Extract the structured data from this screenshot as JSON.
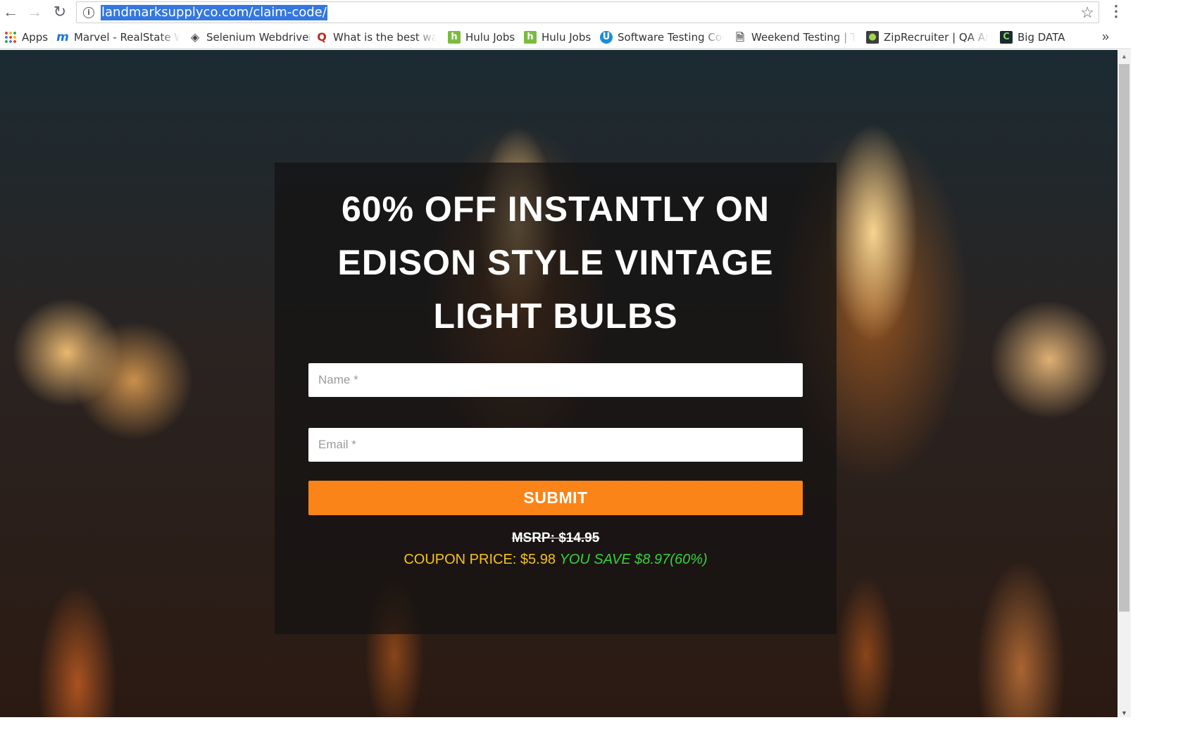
{
  "browser": {
    "url": "landmarksupplyco.com/claim-code/",
    "bookmarks": [
      {
        "label": "Apps",
        "icon": "apps-grid-icon"
      },
      {
        "label": "Marvel - RealState We",
        "icon": "marvel-icon"
      },
      {
        "label": "Selenium Webdriver",
        "icon": "selenium-icon"
      },
      {
        "label": "What is the best way t",
        "icon": "quora-icon"
      },
      {
        "label": "Hulu Jobs",
        "icon": "hulu-icon"
      },
      {
        "label": "Hulu Jobs",
        "icon": "hulu-icon"
      },
      {
        "label": "Software Testing Cour",
        "icon": "udemy-icon"
      },
      {
        "label": "Weekend Testing | Te",
        "icon": "page-icon"
      },
      {
        "label": "ZipRecruiter | QA Ana",
        "icon": "ziprecruiter-icon"
      },
      {
        "label": "Big DATA",
        "icon": "bigdata-icon"
      }
    ],
    "more_bookmarks": "»"
  },
  "offer": {
    "headline_line1": "60% OFF INSTANTLY ON",
    "headline_line2": "EDISON STYLE VINTAGE",
    "headline_line3": "LIGHT BULBS",
    "name_placeholder": "Name *",
    "email_placeholder": "Email *",
    "submit_label": "SUBMIT",
    "msrp": "MSRP: $14.95",
    "coupon_price": "COUPON PRICE: $5.98",
    "you_save": "YOU SAVE $8.97(60%)"
  },
  "colors": {
    "accent": "#fa8417",
    "coupon": "#f6c21a",
    "save": "#38d13a",
    "url_highlight": "#3477e0"
  }
}
